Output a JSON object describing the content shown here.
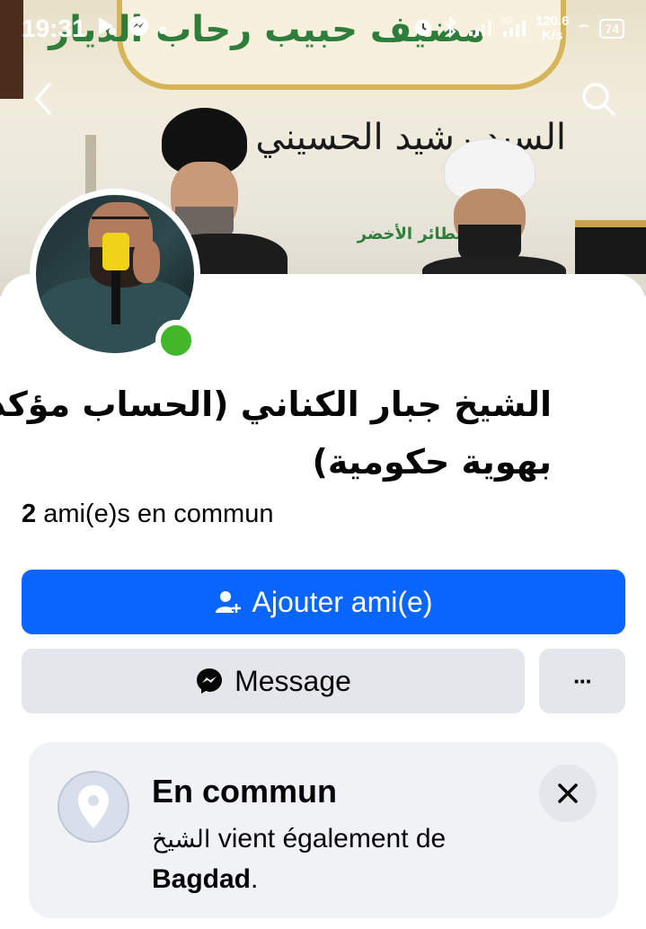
{
  "status_bar": {
    "time": "19:31",
    "network_speed": "120.6",
    "network_speed_unit": "K/s",
    "network_type": "4G",
    "battery": "74"
  },
  "profile": {
    "name_line1": "الشيخ جبار الكناني (الحساب مؤكد",
    "name_line2": "بهوية حكومية)",
    "mutual_count": "2",
    "mutual_label": "ami(e)s en commun",
    "online": true
  },
  "actions": {
    "add_friend_label": "Ajouter ami(e)",
    "message_label": "Message",
    "more_label": "···"
  },
  "in_common": {
    "title": "En commun",
    "desc_arabic": "الشيخ",
    "desc_text": "vient également de",
    "city": "Bagdad",
    "period": "."
  },
  "cover": {
    "banner_text": "مضيف حبيب رحاب الديار",
    "mid_text": "السيد رشيد الحسيني",
    "strip_text": "حركة الطائر الأخضر"
  },
  "colors": {
    "primary": "#0866ff",
    "secondary_button": "#e4e6eb",
    "online": "#42b72a",
    "card_bg": "#f0f2f5"
  }
}
